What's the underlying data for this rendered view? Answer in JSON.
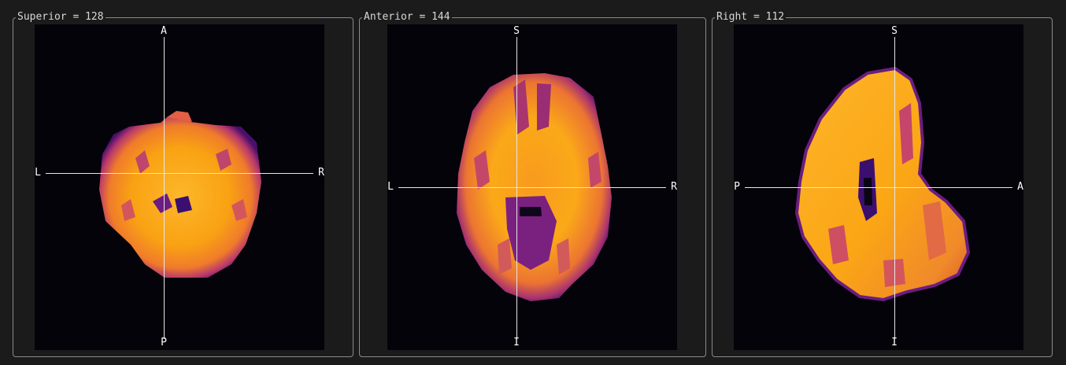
{
  "panels": [
    {
      "title": "Superior = 128",
      "labels": {
        "top": "A",
        "bottom": "P",
        "left": "L",
        "right": "R"
      }
    },
    {
      "title": "Anterior = 144",
      "labels": {
        "top": "S",
        "bottom": "I",
        "left": "L",
        "right": "R"
      }
    },
    {
      "title": "Right = 112",
      "labels": {
        "top": "S",
        "bottom": "I",
        "left": "P",
        "right": "A"
      }
    }
  ],
  "colormap": {
    "background": "#040309",
    "low": "#3b0f70",
    "mid_low": "#8c2981",
    "mid": "#de4968",
    "mid_high": "#f17f3a",
    "high": "#fca50a",
    "peak": "#fcc43a"
  }
}
